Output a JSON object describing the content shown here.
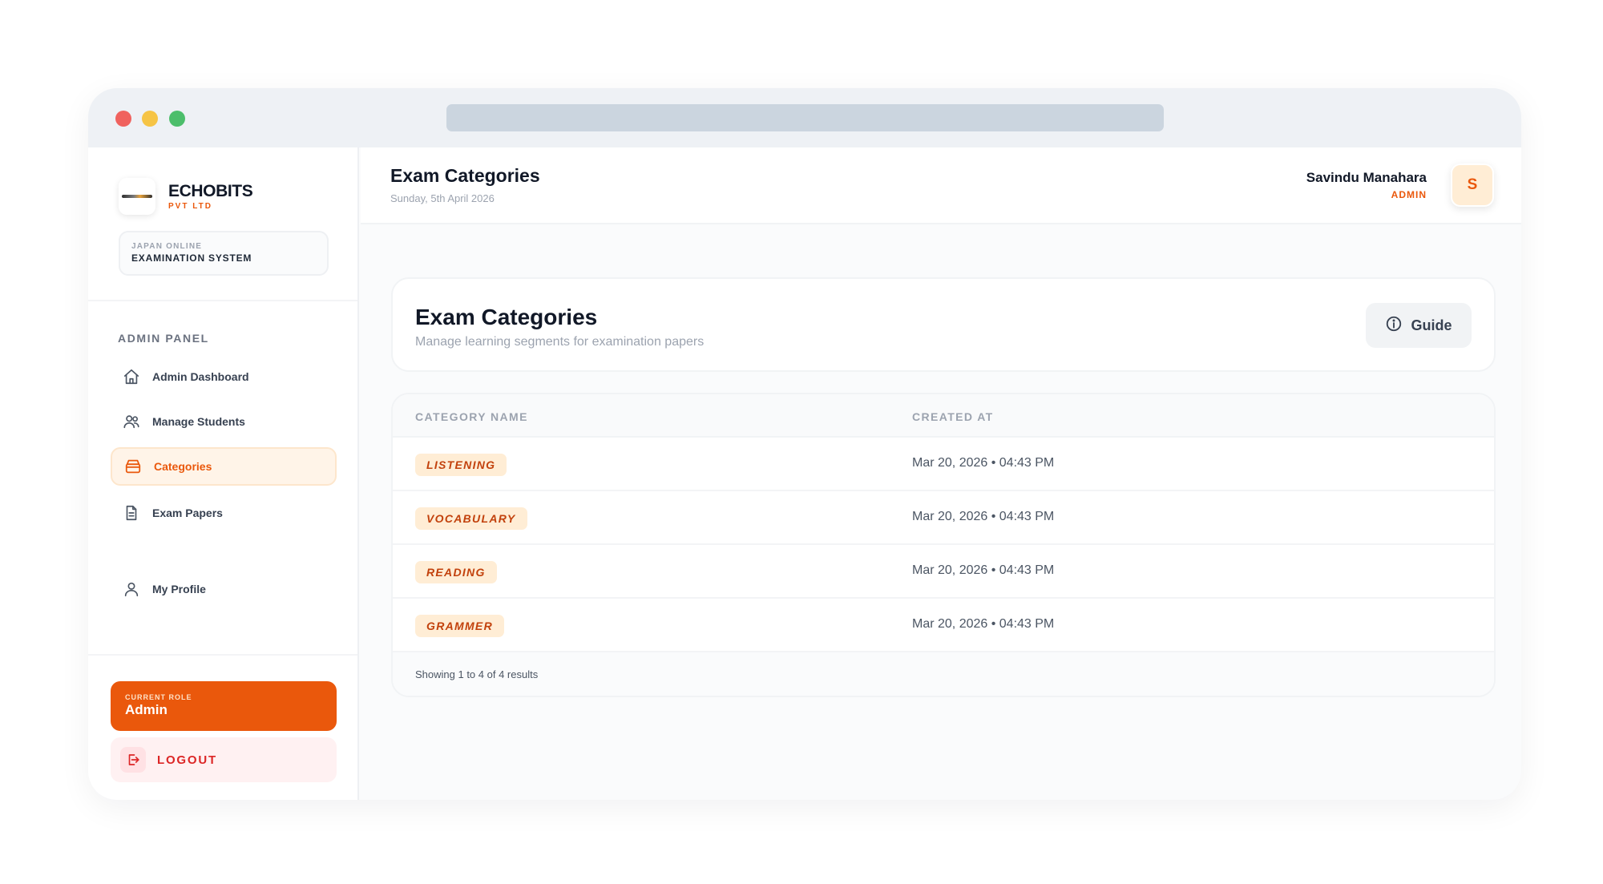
{
  "brand": {
    "name": "ECHOBITS",
    "sub": "PVT LTD"
  },
  "system": {
    "line1": "JAPAN ONLINE",
    "line2": "EXAMINATION SYSTEM"
  },
  "sidebar": {
    "section_label": "ADMIN PANEL",
    "items": [
      {
        "label": "Admin Dashboard",
        "icon": "home-icon",
        "active": false
      },
      {
        "label": "Manage Students",
        "icon": "users-icon",
        "active": false
      },
      {
        "label": "Categories",
        "icon": "box-icon",
        "active": true
      },
      {
        "label": "Exam Papers",
        "icon": "document-icon",
        "active": false
      },
      {
        "label": "My Profile",
        "icon": "user-icon",
        "active": false
      }
    ],
    "role": {
      "label": "CURRENT ROLE",
      "value": "Admin"
    },
    "logout": {
      "label": "LOGOUT",
      "icon": "logout-icon"
    }
  },
  "header": {
    "title": "Exam Categories",
    "date": "Sunday, 5th April 2026",
    "user": {
      "name": "Savindu Manahara",
      "role": "ADMIN",
      "initial": "S"
    }
  },
  "main": {
    "title": "Exam Categories",
    "subtitle": "Manage learning segments for examination papers",
    "guide_label": "Guide",
    "table": {
      "columns": [
        "CATEGORY NAME",
        "CREATED AT"
      ],
      "rows": [
        {
          "name": "LISTENING",
          "created": "Mar 20, 2026 • 04:43 PM"
        },
        {
          "name": "VOCABULARY",
          "created": "Mar 20, 2026 • 04:43 PM"
        },
        {
          "name": "READING",
          "created": "Mar 20, 2026 • 04:43 PM"
        },
        {
          "name": "GRAMMER",
          "created": "Mar 20, 2026 • 04:43 PM"
        }
      ],
      "footer": "Showing 1 to 4 of 4 results"
    }
  },
  "colors": {
    "accent": "#ea580c",
    "badge_bg": "#ffedd5",
    "danger": "#dc2626"
  }
}
